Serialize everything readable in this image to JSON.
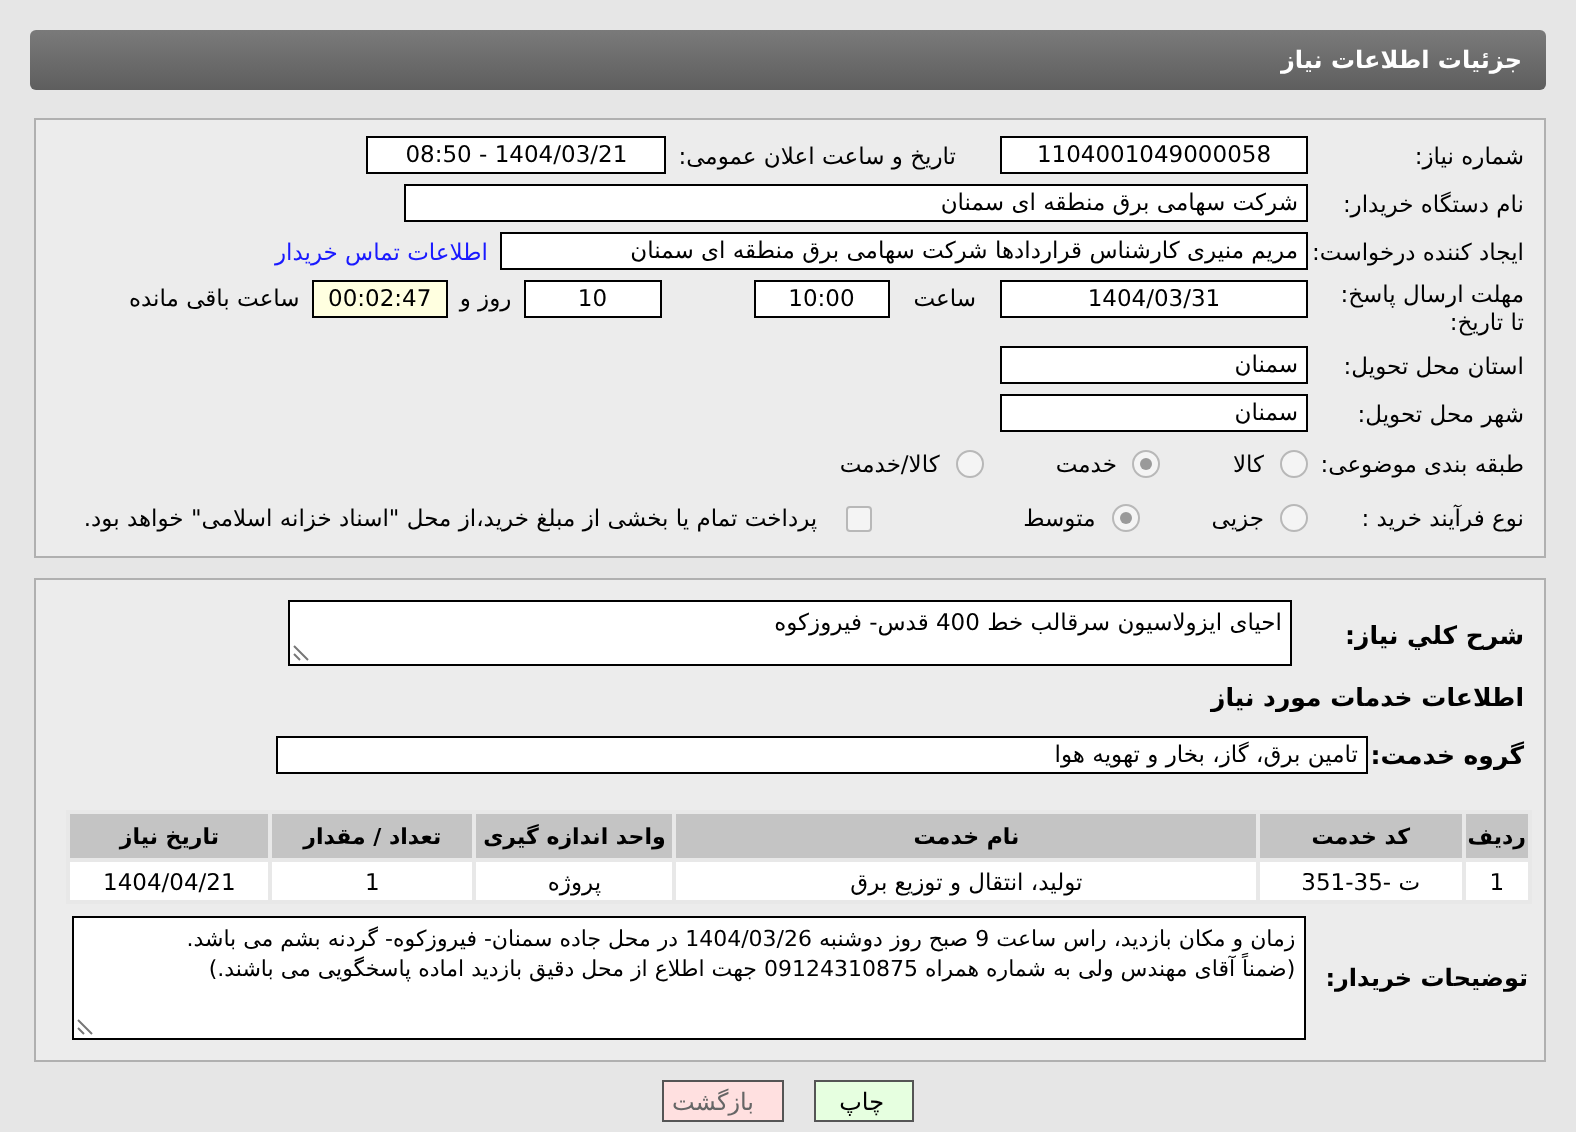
{
  "header": {
    "title": "جزئیات اطلاعات نیاز"
  },
  "details": {
    "need_number": {
      "label": "شماره نیاز:",
      "value": "1104001049000058"
    },
    "announce": {
      "label": "تاریخ و ساعت اعلان عمومی:",
      "value": "1404/03/21 - 08:50"
    },
    "buyer_org": {
      "label": "نام دستگاه خریدار:",
      "value": "شرکت سهامی برق منطقه ای سمنان"
    },
    "requester": {
      "label": "ایجاد کننده درخواست:",
      "value": "مریم منیری کارشناس قراردادها شرکت سهامی برق منطقه ای سمنان",
      "link": "اطلاعات تماس خریدار"
    },
    "deadline": {
      "label": "مهلت ارسال پاسخ: تا تاریخ:",
      "date": "1404/03/31",
      "time_label": "ساعت",
      "time": "10:00",
      "days": "10",
      "days_label": "روز و",
      "remaining": "00:02:47",
      "remaining_label": "ساعت باقی مانده"
    },
    "province": {
      "label": "استان محل تحویل:",
      "value": "سمنان"
    },
    "city": {
      "label": "شهر محل تحویل:",
      "value": "سمنان"
    },
    "category": {
      "label": "طبقه بندی موضوعی:",
      "options": [
        {
          "label": "کالا",
          "selected": false
        },
        {
          "label": "خدمت",
          "selected": true
        },
        {
          "label": "کالا/خدمت",
          "selected": false
        }
      ]
    },
    "process": {
      "label": "نوع فرآیند خرید :",
      "options": [
        {
          "label": "جزیی",
          "selected": false
        },
        {
          "label": "متوسط",
          "selected": true
        }
      ],
      "treasury": {
        "label": "پرداخت تمام یا بخشی از مبلغ خرید،از محل \"اسناد خزانه اسلامی\" خواهد بود.",
        "checked": false
      }
    }
  },
  "needs": {
    "description": {
      "label": "شرح کلي نیاز:",
      "value": "احیای ایزولاسیون سرقالب خط 400 قدس- فیروزکوه"
    },
    "section_title": "اطلاعات خدمات مورد نیاز",
    "service_group": {
      "label": "گروه خدمت:",
      "value": "تامین برق، گاز، بخار و تهویه هوا"
    },
    "table": {
      "columns": [
        "ردیف",
        "کد خدمت",
        "نام خدمت",
        "واحد اندازه گیری",
        "تعداد / مقدار",
        "تاریخ نیاز"
      ],
      "rows": [
        [
          "1",
          "ت -35-351",
          "تولید، انتقال و توزیع برق",
          "پروژه",
          "1",
          "1404/04/21"
        ]
      ]
    },
    "buyer_notes": {
      "label": "توضیحات خریدار:",
      "value": "زمان و مکان بازدید، راس ساعت 9 صبح روز دوشنبه 1404/03/26 در محل جاده سمنان- فیروزکوه- گردنه بشم می باشد.\n(ضمناً آقای مهندس ولی به شماره همراه 09124310875 جهت اطلاع از محل دقیق بازدید اماده پاسخگویی می باشند.)"
    }
  },
  "buttons": [
    {
      "label": "چاپ",
      "kind": "print"
    },
    {
      "label": "بازگشت",
      "kind": "back"
    }
  ]
}
